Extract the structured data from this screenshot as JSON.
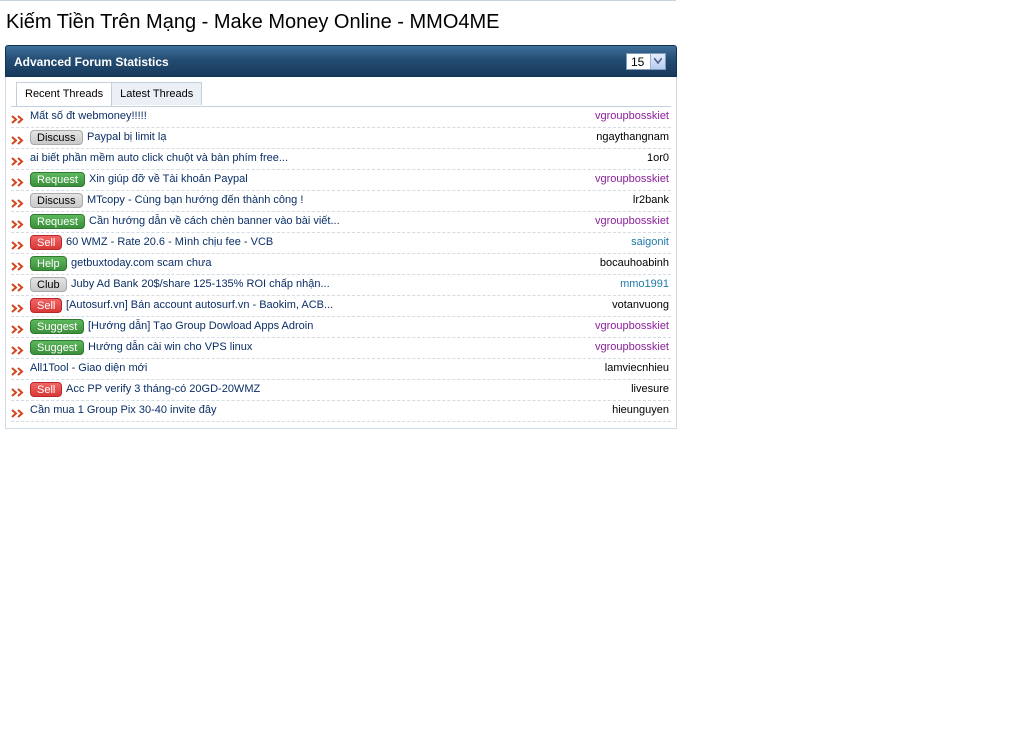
{
  "page": {
    "title": "Kiếm Tiền Trên Mạng - Make Money Online - MMO4ME"
  },
  "stats": {
    "title": "Advanced Forum Statistics",
    "limit_value": "15",
    "tabs": [
      {
        "label": "Recent Threads",
        "active": true
      },
      {
        "label": "Latest Threads",
        "active": false
      }
    ],
    "colors": {
      "header": "#254d73",
      "link": "#0b2f66",
      "author_purple": "#8b1f9c",
      "author_blue": "#1e7aa8"
    },
    "threads": [
      {
        "prefix": "",
        "prefix_type": "",
        "title": "Mất số đt webmoney!!!!!",
        "author": "vgroupbosskiet",
        "author_color": "purple"
      },
      {
        "prefix": "Discuss",
        "prefix_type": "discuss",
        "title": "Paypal bị limit lạ",
        "author": "ngaythangnam",
        "author_color": "black"
      },
      {
        "prefix": "",
        "prefix_type": "",
        "title": "ai biết phần mềm auto click chuột và bàn phím free...",
        "author": "1or0",
        "author_color": "black"
      },
      {
        "prefix": "Request",
        "prefix_type": "request",
        "title": "Xin giúp đỡ về Tài khoản Paypal",
        "author": "vgroupbosskiet",
        "author_color": "purple"
      },
      {
        "prefix": "Discuss",
        "prefix_type": "discuss",
        "title": "MTcopy - Cùng bạn hướng đến thành công !",
        "author": "lr2bank",
        "author_color": "black"
      },
      {
        "prefix": "Request",
        "prefix_type": "request",
        "title": "Cần hướng dẫn về cách chèn banner vào bài viết...",
        "author": "vgroupbosskiet",
        "author_color": "purple"
      },
      {
        "prefix": "Sell",
        "prefix_type": "sell",
        "title": "60 WMZ - Rate 20.6 - Mình chịu fee - VCB",
        "author": "saigonit",
        "author_color": "blue"
      },
      {
        "prefix": "Help",
        "prefix_type": "help",
        "title": "getbuxtoday.com scam chưa",
        "author": "bocauhoabinh",
        "author_color": "black"
      },
      {
        "prefix": "Club",
        "prefix_type": "club",
        "title": "Juby Ad Bank 20$/share 125-135% ROI chấp nhận...",
        "author": "mmo1991",
        "author_color": "blue"
      },
      {
        "prefix": "Sell",
        "prefix_type": "sell",
        "title": "[Autosurf.vn] Bán account autosurf.vn - Baokim, ACB...",
        "author": "votanvuong",
        "author_color": "black"
      },
      {
        "prefix": "Suggest",
        "prefix_type": "suggest",
        "title": "[Hướng dẫn] Tạo Group Dowload Apps Adroin",
        "author": "vgroupbosskiet",
        "author_color": "purple"
      },
      {
        "prefix": "Suggest",
        "prefix_type": "suggest",
        "title": "Hướng dẫn cài win cho VPS linux",
        "author": "vgroupbosskiet",
        "author_color": "purple"
      },
      {
        "prefix": "",
        "prefix_type": "",
        "title": "All1Tool - Giao diện mới",
        "author": "lamviecnhieu",
        "author_color": "black"
      },
      {
        "prefix": "Sell",
        "prefix_type": "sell",
        "title": "Acc PP verify 3 tháng-có 20GD-20WMZ",
        "author": "livesure",
        "author_color": "black"
      },
      {
        "prefix": "",
        "prefix_type": "",
        "title": "Cần mua 1 Group Pix 30-40 invite đây",
        "author": "hieunguyen",
        "author_color": "black"
      }
    ]
  }
}
